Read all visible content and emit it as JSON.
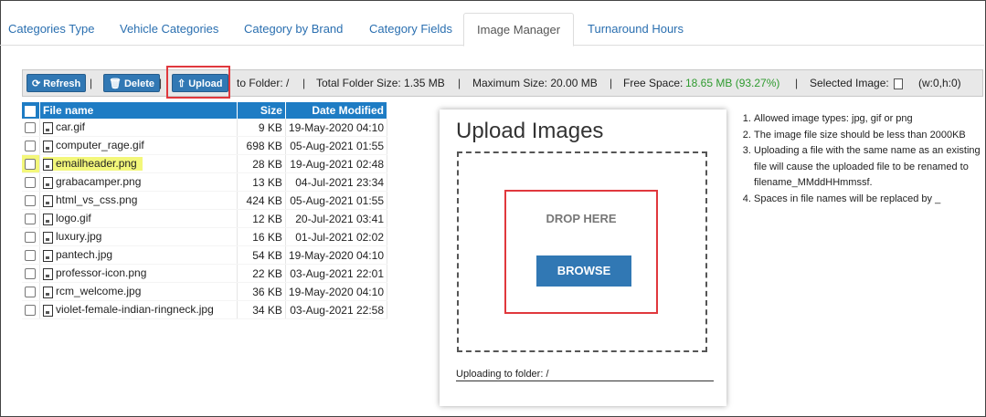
{
  "tabs": [
    {
      "label": "Categories Type"
    },
    {
      "label": "Vehicle Categories"
    },
    {
      "label": "Category by Brand"
    },
    {
      "label": "Category Fields"
    },
    {
      "label": "Image Manager"
    },
    {
      "label": "Turnaround Hours"
    }
  ],
  "toolbar": {
    "refresh_label": "Refresh",
    "delete_label": "Delete",
    "upload_label": "Upload",
    "separator": "|",
    "to_folder": "to Folder: /",
    "total_size": "Total Folder Size: 1.35 MB",
    "max_size": "Maximum Size: 20.00 MB",
    "free_space_label": "Free Space:",
    "free_space_value": "18.65 MB (93.27%)",
    "selected_image_label": "Selected Image:",
    "selected_image_dims": "(w:0,h:0)",
    "free_space_color": "#2e9a2e"
  },
  "file_table": {
    "headers": {
      "name": "File name",
      "size": "Size",
      "modified": "Date Modified"
    },
    "rows": [
      {
        "name": "car.gif",
        "size": "9 KB",
        "date": "19-May-2020 04:10"
      },
      {
        "name": "computer_rage.gif",
        "size": "698 KB",
        "date": "05-Aug-2021 01:55"
      },
      {
        "name": "emailheader.png",
        "size": "28 KB",
        "date": "19-Aug-2021 02:48"
      },
      {
        "name": "grabacamper.png",
        "size": "13 KB",
        "date": "04-Jul-2021 23:34"
      },
      {
        "name": "html_vs_css.png",
        "size": "424 KB",
        "date": "05-Aug-2021 01:55"
      },
      {
        "name": "logo.gif",
        "size": "12 KB",
        "date": "20-Jul-2021 03:41"
      },
      {
        "name": "luxury.jpg",
        "size": "16 KB",
        "date": "01-Jul-2021 02:02"
      },
      {
        "name": "pantech.jpg",
        "size": "54 KB",
        "date": "19-May-2020 04:10"
      },
      {
        "name": "professor-icon.png",
        "size": "22 KB",
        "date": "03-Aug-2021 22:01"
      },
      {
        "name": "rcm_welcome.jpg",
        "size": "36 KB",
        "date": "19-May-2020 04:10"
      },
      {
        "name": "violet-female-indian-ringneck.jpg",
        "size": "34 KB",
        "date": "03-Aug-2021 22:58"
      }
    ]
  },
  "upload_panel": {
    "title": "Upload Images",
    "drop_text": "DROP HERE",
    "browse_label": "BROWSE",
    "uploading_to": "Uploading to folder: /"
  },
  "rules": [
    "Allowed image types: jpg, gif or png",
    "The image file size should be less than 2000KB",
    "Uploading a file with the same name as an existing file will cause the uploaded file to be renamed to filename_MMddHHmmssf.",
    "Spaces in file names will be replaced by _"
  ],
  "colors": {
    "accent": "#3178b4",
    "header_blue": "#1e7cc4",
    "highlight_red": "#e0383d",
    "row_highlight": "#f3f77a"
  }
}
